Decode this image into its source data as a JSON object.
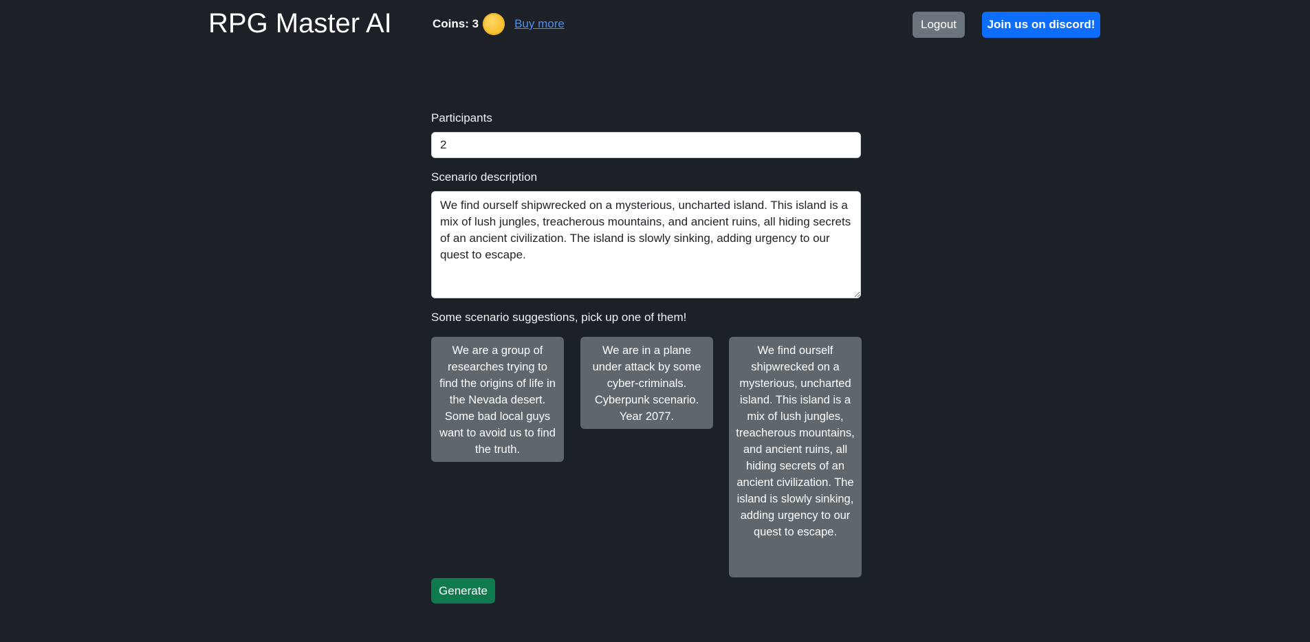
{
  "header": {
    "brand": "RPG Master AI",
    "coins_label": "Coins: 3",
    "coin_icon": "coin-icon",
    "buy_more": "Buy more",
    "logout": "Logout",
    "discord": "Join us on discord!"
  },
  "form": {
    "participants_label": "Participants",
    "participants_value": "2",
    "scenario_label": "Scenario description",
    "scenario_value": "We find ourself shipwrecked on a mysterious, uncharted island. This island is a mix of lush jungles, treacherous mountains, and ancient ruins, all hiding secrets of an ancient civilization. The island is slowly sinking, adding urgency to our quest to escape.",
    "suggestions_title": "Some scenario suggestions, pick up one of them!",
    "suggestions": [
      "We are a group of researches trying to find the origins of life in the Nevada desert. Some bad local guys want to avoid us to find the truth.",
      "We are in a plane under attack by some cyber-criminals. Cyberpunk scenario. Year 2077.",
      "We find ourself shipwrecked on a mysterious, uncharted island. This island is a mix of lush jungles, treacherous mountains, and ancient ruins, all hiding secrets of an ancient civilization. The island is slowly sinking, adding urgency to our quest to escape."
    ],
    "generate": "Generate"
  },
  "colors": {
    "background": "#1b2126",
    "logout": "#6c757d",
    "discord": "#0d6efd",
    "generate": "#0f7a4d",
    "suggestion_card": "#5f676d",
    "link": "#4d8ef7"
  }
}
